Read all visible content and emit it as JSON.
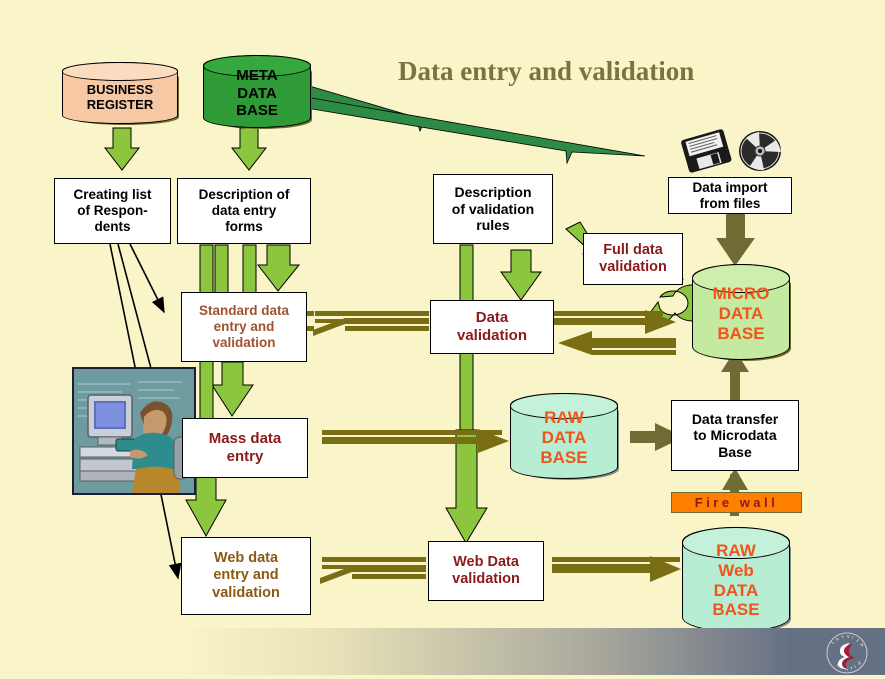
{
  "page": {
    "title": "Data entry and validation",
    "background_color": "#FAF5C8"
  },
  "colors": {
    "background": "#FAF5C8",
    "title_text": "#7A7340",
    "green_arrow": "#8CC63E",
    "olive_arrow": "#7A6E15",
    "dark_olive_arrow": "#6E6B34",
    "meta_db_fill": "#2E9B36",
    "business_db_fill": "#F6C9A4",
    "micro_db_fill": "#C3EAA0",
    "raw_db_fill": "#B7EDD2",
    "firewall_fill": "#FF7F00",
    "maroon_text": "#8B1A1A",
    "orange_text": "#F2541B",
    "sienna_text": "#A0522D",
    "brown_text": "#8B5A13",
    "footer_gray": "#667085"
  },
  "databases": [
    {
      "id": "business-register",
      "lines": [
        "BUSINESS",
        "REGISTER"
      ],
      "fill": "#F6C9A4",
      "text_color": "#000000",
      "font_size": 13
    },
    {
      "id": "meta-data-base",
      "lines": [
        "META",
        "DATA",
        "BASE"
      ],
      "fill": "#2E9B36",
      "text_color": "#000000",
      "font_size": 15
    },
    {
      "id": "micro-data-base",
      "lines": [
        "MICRO",
        "DATA",
        "BASE"
      ],
      "fill": "#C3EAA0",
      "text_color": "#F2541B",
      "font_size": 17
    },
    {
      "id": "raw-data-base",
      "lines": [
        "RAW",
        "DATA",
        "BASE"
      ],
      "fill": "#B7EDD2",
      "text_color": "#F2541B",
      "font_size": 17
    },
    {
      "id": "raw-web-data-base",
      "lines": [
        "RAW",
        "Web",
        "DATA",
        "BASE"
      ],
      "fill": "#B7EDD2",
      "text_color": "#F2541B",
      "font_size": 17
    }
  ],
  "boxes": {
    "creating_list": "Creating list of Respon-dents",
    "creating_list_lines": [
      "Creating list",
      "of Respon-",
      "dents"
    ],
    "description_forms_lines": [
      "Description of",
      "data entry",
      "forms"
    ],
    "description_rules_lines": [
      "Description",
      "of validation",
      "rules"
    ],
    "data_import_lines": [
      "Data import",
      "from files"
    ],
    "standard_entry_lines": [
      "Standard data",
      "entry and",
      "validation"
    ],
    "full_validation_lines": [
      "Full data",
      "validation"
    ],
    "data_validation_lines": [
      "Data",
      "validation"
    ],
    "mass_entry_lines": [
      "Mass data",
      "entry"
    ],
    "data_transfer_lines": [
      "Data transfer",
      "to Microdata",
      "Base"
    ],
    "web_entry_lines": [
      "Web data",
      "entry and",
      "validation"
    ],
    "web_validation_lines": [
      "Web Data",
      "validation"
    ]
  },
  "firewall": {
    "label": "Fire wall"
  },
  "icons": {
    "floppy": "floppy-disk-icon",
    "cd": "cd-disc-icon",
    "workstation": "person-at-computer-clipart",
    "logo": "organization-logo"
  }
}
